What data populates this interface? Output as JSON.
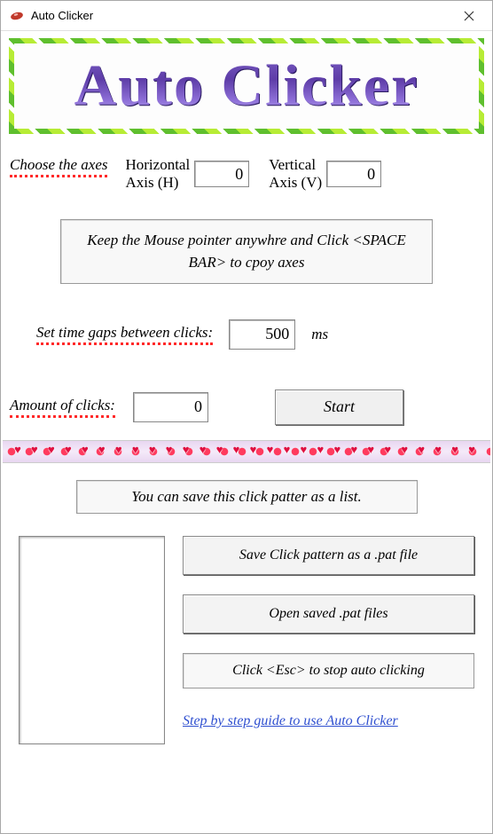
{
  "titlebar": {
    "title": "Auto Clicker"
  },
  "banner": {
    "text": "Auto Clicker"
  },
  "axes": {
    "choose_label": "Choose the axes",
    "h_label": "Horizontal\nAxis (H)",
    "h_value": "0",
    "v_label": "Vertical\nAxis (V)",
    "v_value": "0"
  },
  "spacebar_hint": "Keep the Mouse pointer anywhre and Click <SPACE BAR> to cpoy axes",
  "timegap": {
    "label": "Set time gaps between clicks:",
    "value": "500",
    "unit": "ms"
  },
  "amount": {
    "label": "Amount of clicks:",
    "value": "0"
  },
  "start_label": "Start",
  "save_hint": "You can save this click patter as a list.",
  "buttons": {
    "save": "Save Click pattern as a .pat file",
    "open": "Open saved .pat files"
  },
  "esc_hint": "Click <Esc> to stop auto clicking",
  "guide_link": "Step by step guide to use Auto Clicker"
}
